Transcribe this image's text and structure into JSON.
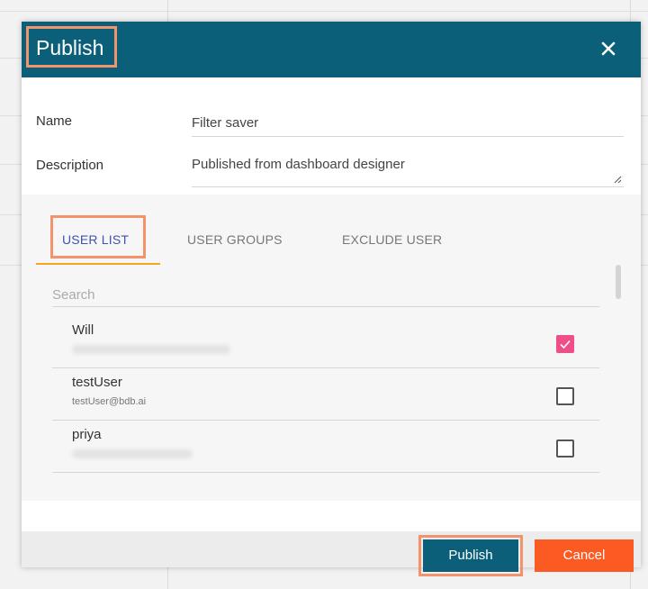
{
  "dialog": {
    "title": "Publish",
    "close_icon": "close-icon"
  },
  "form": {
    "name_label": "Name",
    "name_value": "Filter saver",
    "description_label": "Description",
    "description_value": "Published from dashboard designer"
  },
  "tabs": [
    {
      "label": "USER LIST",
      "active": true
    },
    {
      "label": "USER GROUPS",
      "active": false
    },
    {
      "label": "EXCLUDE USER",
      "active": false
    }
  ],
  "search": {
    "placeholder": "Search"
  },
  "users": [
    {
      "name": "Will",
      "email": "",
      "email_obscured": true,
      "checked": true
    },
    {
      "name": "testUser",
      "email": "testUser@bdb.ai",
      "email_obscured": false,
      "checked": false
    },
    {
      "name": "priya",
      "email": "",
      "email_obscured": true,
      "checked": false
    }
  ],
  "footer": {
    "publish_label": "Publish",
    "cancel_label": "Cancel"
  },
  "colors": {
    "header": "#0c5f79",
    "highlight_outline": "#f2936b",
    "tab_underline": "#f5a623",
    "tab_active_text": "#3f51b5",
    "checkbox_checked": "#f04e89",
    "cancel_button": "#fb5b22"
  }
}
